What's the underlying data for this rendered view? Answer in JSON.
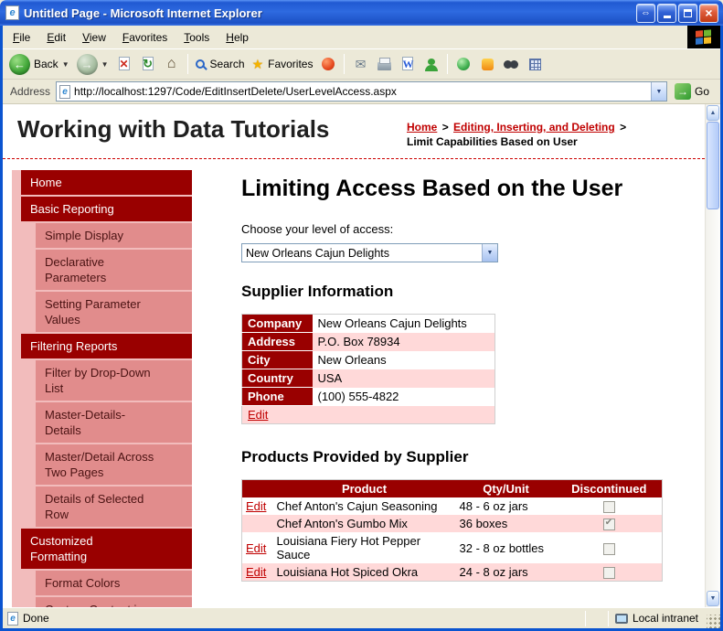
{
  "window": {
    "title": "Untitled Page - Microsoft Internet Explorer",
    "menu": [
      "File",
      "Edit",
      "View",
      "Favorites",
      "Tools",
      "Help"
    ],
    "toolbar": {
      "back_label": "Back",
      "search_label": "Search",
      "favorites_label": "Favorites"
    },
    "address": {
      "label": "Address",
      "url": "http://localhost:1297/Code/EditInsertDelete/UserLevelAccess.aspx",
      "go_label": "Go"
    },
    "status": {
      "left": "Done",
      "right": "Local intranet"
    }
  },
  "page": {
    "site_title": "Working with Data Tutorials",
    "breadcrumb": [
      {
        "label": "Home"
      },
      {
        "label": ">"
      },
      {
        "label": "Editing, Inserting, and Deleting"
      },
      {
        "label": ">"
      },
      {
        "label": "Limit Capabilities Based on User"
      }
    ],
    "sidebar": [
      {
        "label": "Home",
        "type": "header"
      },
      {
        "label": "Basic Reporting",
        "type": "header"
      },
      {
        "label": "Simple Display",
        "type": "item"
      },
      {
        "label": "Declarative Parameters",
        "type": "item"
      },
      {
        "label": "Setting Parameter Values",
        "type": "item"
      },
      {
        "label": "Filtering Reports",
        "type": "header"
      },
      {
        "label": "Filter by Drop-Down List",
        "type": "item"
      },
      {
        "label": "Master-Details-Details",
        "type": "item"
      },
      {
        "label": "Master/Detail Across Two Pages",
        "type": "item"
      },
      {
        "label": "Details of Selected Row",
        "type": "item"
      },
      {
        "label": "Customized Formatting",
        "type": "header"
      },
      {
        "label": "Format Colors",
        "type": "item"
      },
      {
        "label": "Custom Content in a",
        "type": "item"
      }
    ],
    "main": {
      "title": "Limiting Access Based on the User",
      "access_label": "Choose your level of access:",
      "access_value": "New Orleans Cajun Delights",
      "supplier_heading": "Supplier Information",
      "supplier": {
        "rows": [
          {
            "label": "Company",
            "value": "New Orleans Cajun Delights"
          },
          {
            "label": "Address",
            "value": "P.O. Box 78934"
          },
          {
            "label": "City",
            "value": "New Orleans"
          },
          {
            "label": "Country",
            "value": "USA"
          },
          {
            "label": "Phone",
            "value": "(100) 555-4822"
          }
        ],
        "edit_label": "Edit"
      },
      "products_heading": "Products Provided by Supplier",
      "products": {
        "columns": [
          "",
          "Product",
          "Qty/Unit",
          "Discontinued"
        ],
        "rows": [
          {
            "edit": "Edit",
            "product": "Chef Anton's Cajun Seasoning",
            "qty": "48 - 6 oz jars",
            "discontinued": false
          },
          {
            "edit": "",
            "product": "Chef Anton's Gumbo Mix",
            "qty": "36 boxes",
            "discontinued": true
          },
          {
            "edit": "Edit",
            "product": "Louisiana Fiery Hot Pepper Sauce",
            "qty": "32 - 8 oz bottles",
            "discontinued": false
          },
          {
            "edit": "Edit",
            "product": "Louisiana Hot Spiced Okra",
            "qty": "24 - 8 oz jars",
            "discontinued": false
          }
        ]
      }
    }
  },
  "colors": {
    "titlebar_blue": "#2e6ae0",
    "maroon": "#990000",
    "nav_item_pink": "#e18c8c",
    "nav_strip_pink": "#f2bcbc",
    "row_pink": "#ffd9d9",
    "link_red": "#c00000",
    "chrome_tan": "#ece9d8"
  }
}
